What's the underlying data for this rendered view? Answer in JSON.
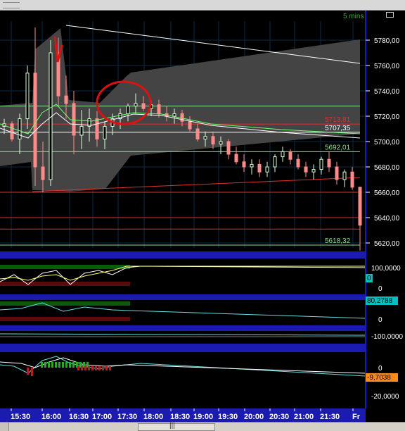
{
  "chart_data": {
    "type": "candlestick",
    "timeframe": "5 mins",
    "x_ticks": [
      "15:30",
      "16:00",
      "16:30",
      "17:00",
      "17:30",
      "18:00",
      "18:30",
      "19:00",
      "19:30",
      "20:00",
      "20:30",
      "21:00",
      "21:30",
      "Fr"
    ],
    "price_ticks": [
      "5780,00",
      "5760,00",
      "5740,00",
      "5720,00",
      "5700,00",
      "5680,00",
      "5660,00",
      "5640,00",
      "5620,00"
    ],
    "price_ylim": [
      5613,
      5796
    ],
    "horizontal_levels": [
      {
        "label": "5713,81",
        "value": 5713.81,
        "color": "#e03030"
      },
      {
        "label": "5707,35",
        "value": 5707.35,
        "color": "#ffffff"
      },
      {
        "label": "5692,01",
        "value": 5692.01,
        "color": "#8fe08f"
      },
      {
        "label": "5618,32",
        "value": 5618.32,
        "color": "#8fe08f"
      }
    ],
    "candles": [
      [
        5712,
        5718,
        5706,
        5714
      ],
      [
        5714,
        5716,
        5700,
        5702
      ],
      [
        5702,
        5722,
        5690,
        5718
      ],
      [
        5718,
        5760,
        5710,
        5754
      ],
      [
        5754,
        5790,
        5665,
        5680
      ],
      [
        5680,
        5700,
        5660,
        5670
      ],
      [
        5670,
        5780,
        5665,
        5770
      ],
      [
        5770,
        5782,
        5728,
        5736
      ],
      [
        5736,
        5752,
        5718,
        5730
      ],
      [
        5730,
        5740,
        5690,
        5705
      ],
      [
        5705,
        5725,
        5694,
        5712
      ],
      [
        5712,
        5726,
        5700,
        5718
      ],
      [
        5718,
        5724,
        5696,
        5702
      ],
      [
        5702,
        5716,
        5694,
        5712
      ],
      [
        5712,
        5722,
        5705,
        5718
      ],
      [
        5718,
        5726,
        5710,
        5722
      ],
      [
        5722,
        5730,
        5716,
        5728
      ],
      [
        5728,
        5738,
        5722,
        5730
      ],
      [
        5730,
        5736,
        5724,
        5726
      ],
      [
        5726,
        5732,
        5720,
        5729
      ],
      [
        5729,
        5733,
        5719,
        5722
      ],
      [
        5722,
        5728,
        5716,
        5720
      ],
      [
        5720,
        5726,
        5714,
        5722
      ],
      [
        5722,
        5725,
        5712,
        5716
      ],
      [
        5716,
        5720,
        5708,
        5710
      ],
      [
        5710,
        5714,
        5700,
        5702
      ],
      [
        5702,
        5708,
        5696,
        5704
      ],
      [
        5704,
        5708,
        5694,
        5698
      ],
      [
        5698,
        5704,
        5690,
        5700
      ],
      [
        5700,
        5702,
        5686,
        5690
      ],
      [
        5690,
        5696,
        5682,
        5684
      ],
      [
        5684,
        5690,
        5676,
        5680
      ],
      [
        5680,
        5686,
        5674,
        5682
      ],
      [
        5682,
        5686,
        5672,
        5676
      ],
      [
        5676,
        5684,
        5672,
        5680
      ],
      [
        5680,
        5690,
        5676,
        5688
      ],
      [
        5688,
        5696,
        5684,
        5692
      ],
      [
        5692,
        5694,
        5682,
        5686
      ],
      [
        5686,
        5690,
        5678,
        5680
      ],
      [
        5680,
        5684,
        5672,
        5676
      ],
      [
        5676,
        5682,
        5670,
        5678
      ],
      [
        5678,
        5688,
        5674,
        5686
      ],
      [
        5686,
        5692,
        5676,
        5680
      ],
      [
        5680,
        5684,
        5666,
        5670
      ],
      [
        5670,
        5678,
        5664,
        5676
      ],
      [
        5676,
        5680,
        5662,
        5664
      ],
      [
        5664,
        5636,
        5614,
        5634
      ]
    ],
    "annotations": [
      {
        "type": "circle",
        "color": "#e01010",
        "note": "red freehand circle around 17:30-18:00 highs"
      },
      {
        "type": "arrow",
        "color": "#e01010",
        "note": "red freehand arrow near 16:15"
      }
    ],
    "indicators": [
      {
        "name": "panel-1",
        "ticks": [
          "100,0000"
        ],
        "value_badge": "0",
        "badge_color": "#00c0c0",
        "zero_label": "0"
      },
      {
        "name": "panel-2",
        "ticks": [],
        "value_badge": "80,2788",
        "badge_color": "#00c0c0",
        "zero_label": "0"
      },
      {
        "name": "panel-3",
        "ticks": [
          "-100,0000"
        ],
        "value_badge": "",
        "badge_color": "",
        "zero_label": ""
      },
      {
        "name": "panel-4",
        "ticks": [
          "0",
          "-20,0000"
        ],
        "value_badge": "-9,7038",
        "badge_color": "#ff8c1a",
        "zero_label": ""
      }
    ]
  },
  "colors": {
    "background": "#000000",
    "panel_border": "#1b1bb0",
    "axis_text": "#ffffff",
    "up_candle": "#d8ffd8",
    "down_candle": "#ff8a8a",
    "band_fill": "#4a4a4a",
    "grid": "#0e2a40"
  }
}
